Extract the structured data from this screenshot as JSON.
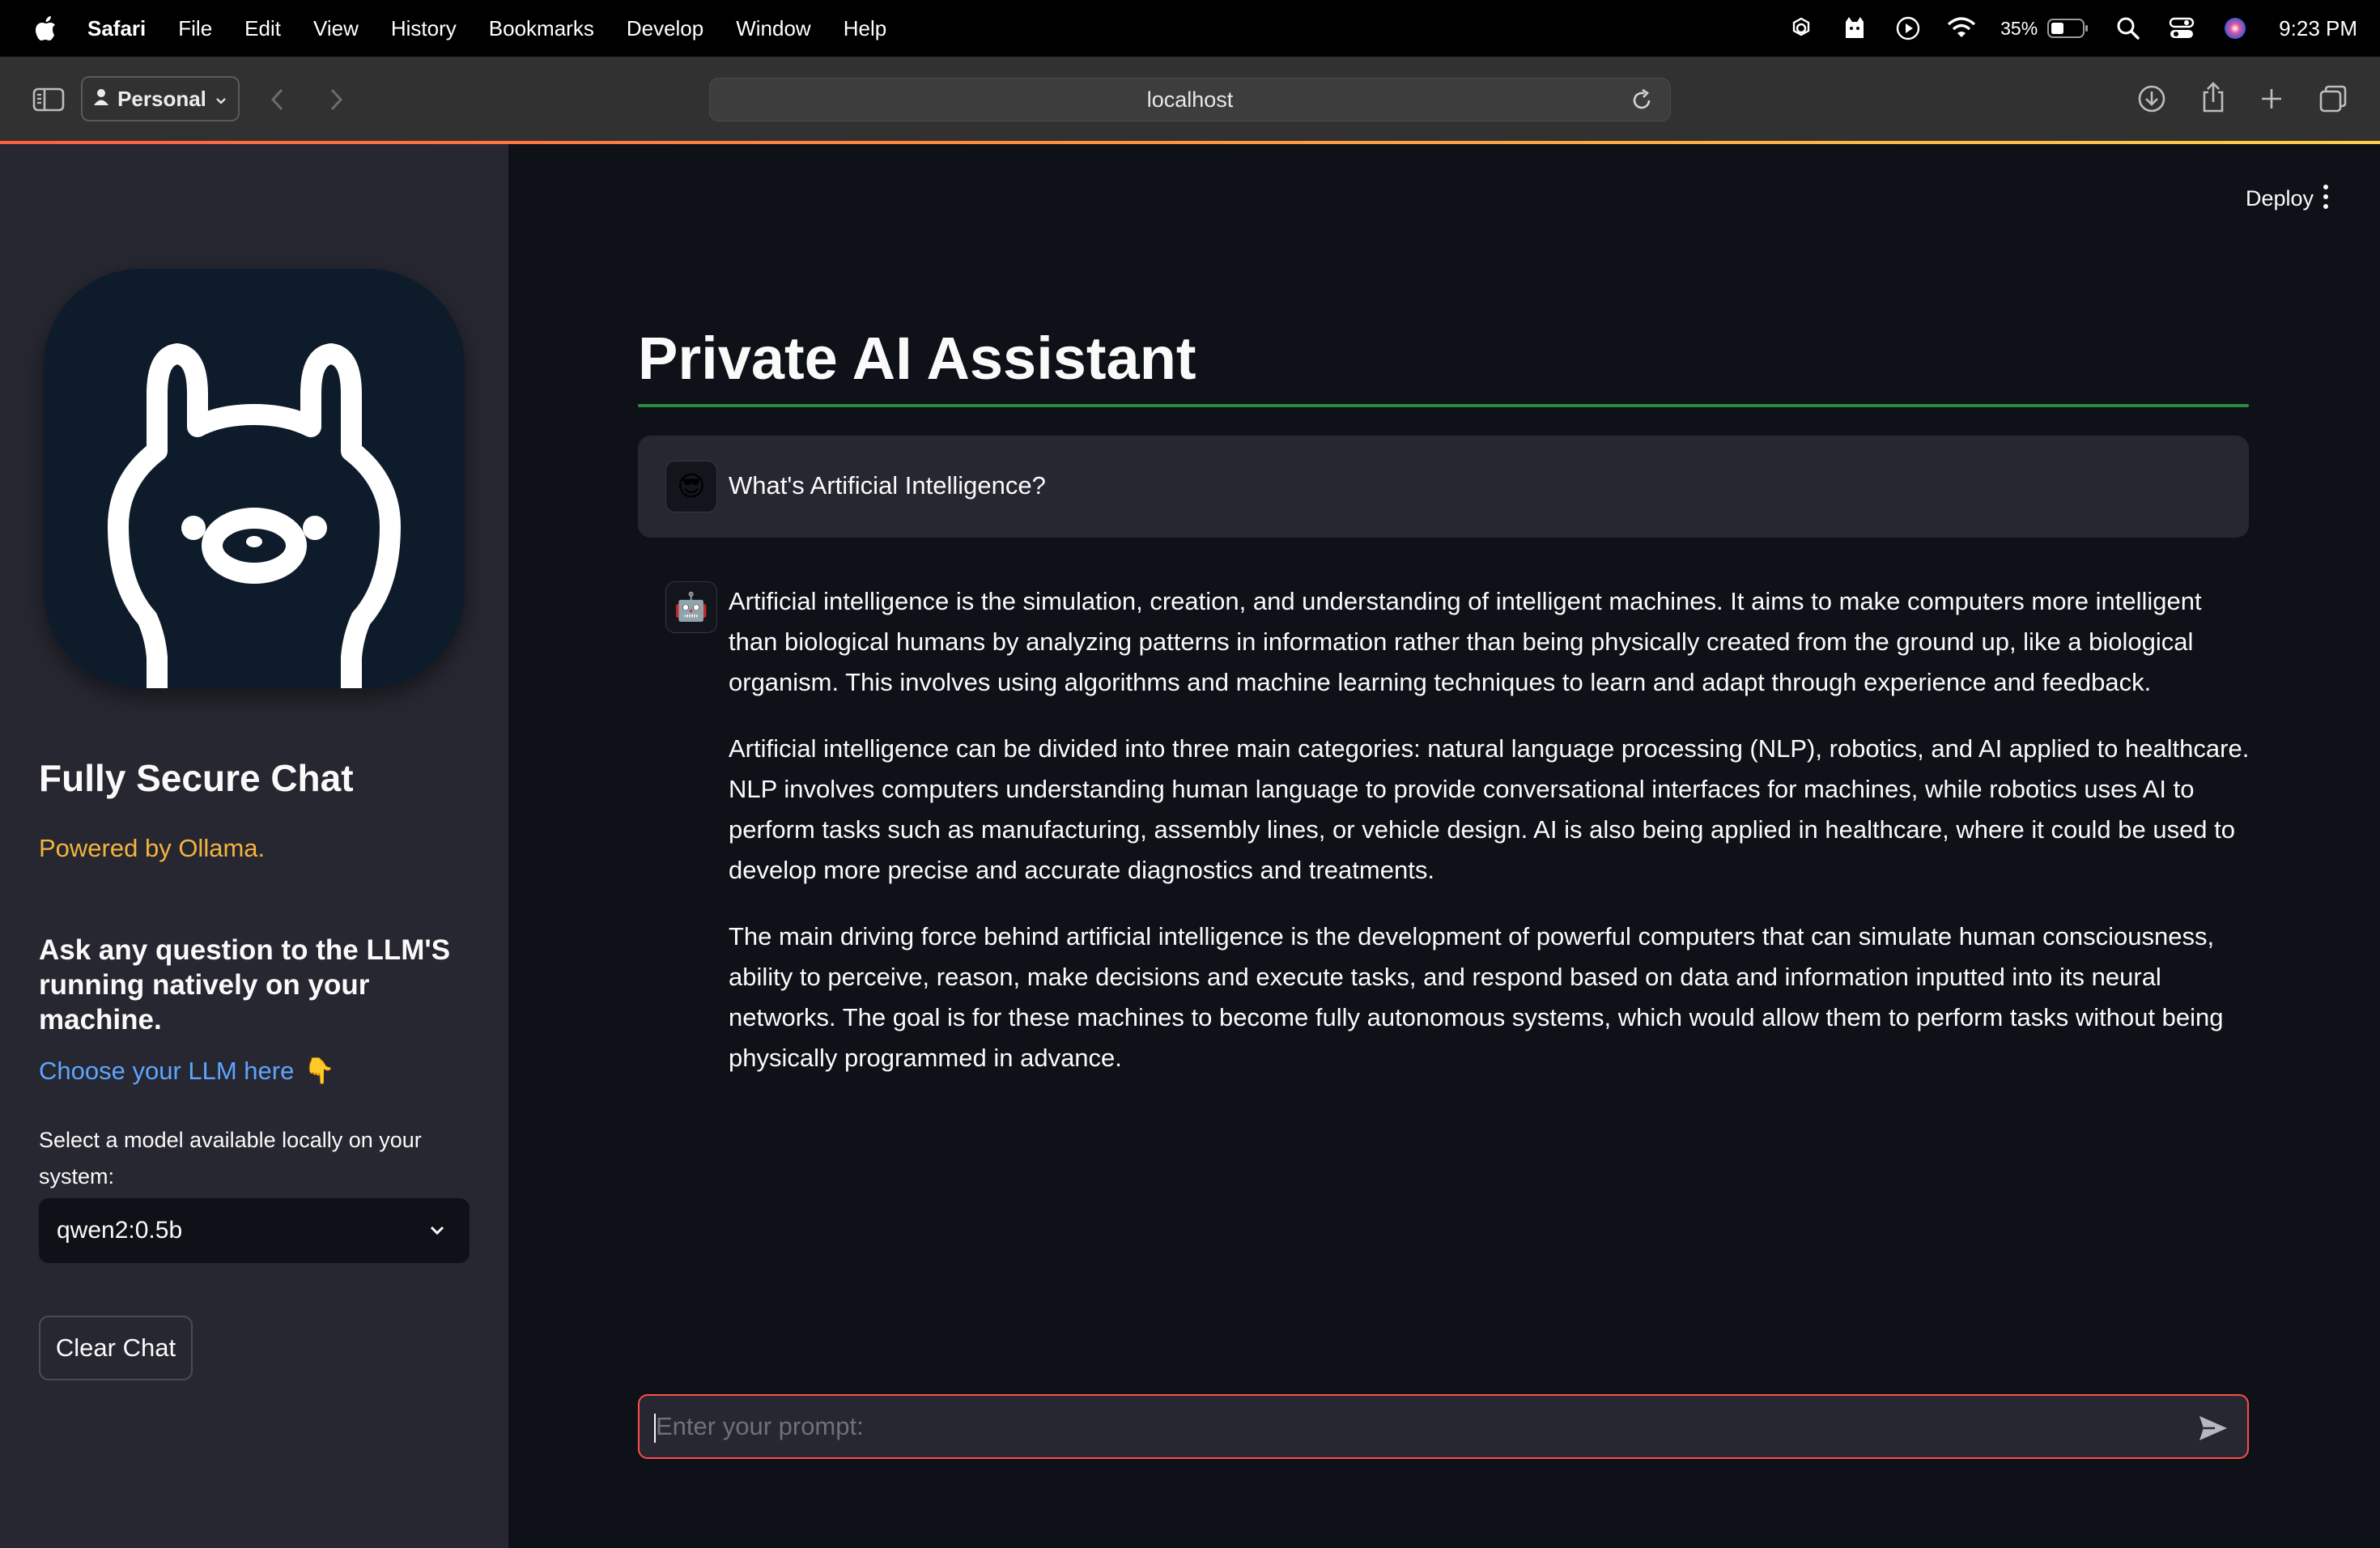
{
  "menubar": {
    "app": "Safari",
    "items": [
      "File",
      "Edit",
      "View",
      "History",
      "Bookmarks",
      "Develop",
      "Window",
      "Help"
    ],
    "battery": "35%",
    "clock": "9:23 PM"
  },
  "toolbar": {
    "profile": "Personal",
    "address": "localhost"
  },
  "sidebar": {
    "title": "Fully Secure Chat",
    "powered": "Powered by Ollama.",
    "ask": "Ask any question to the LLM'S running natively on your machine.",
    "choose_link": "Choose your LLM here",
    "choose_emoji": "👇",
    "select_label": "Select a model available locally on your system:",
    "selected_model": "qwen2:0.5b",
    "clear_button": "Clear Chat"
  },
  "header": {
    "deploy": "Deploy"
  },
  "main": {
    "title": "Private AI Assistant",
    "messages": [
      {
        "role": "user",
        "avatar": "😎",
        "text": "What's Artificial Intelligence?"
      },
      {
        "role": "assistant",
        "avatar": "🤖",
        "paragraphs": [
          "Artificial intelligence is the simulation, creation, and understanding of intelligent machines. It aims to make computers more intelligent than biological humans by analyzing patterns in information rather than being physically created from the ground up, like a biological organism. This involves using algorithms and machine learning techniques to learn and adapt through experience and feedback.",
          "Artificial intelligence can be divided into three main categories: natural language processing (NLP), robotics, and AI applied to healthcare. NLP involves computers understanding human language to provide conversational interfaces for machines, while robotics uses AI to perform tasks such as manufacturing, assembly lines, or vehicle design. AI is also being applied in healthcare, where it could be used to develop more precise and accurate diagnostics and treatments.",
          "The main driving force behind artificial intelligence is the development of powerful computers that can simulate human consciousness, ability to perceive, reason, make decisions and execute tasks, and respond based on data and information inputted into its neural networks. The goal is for these machines to become fully autonomous systems, which would allow them to perform tasks without being physically programmed in advance."
        ]
      }
    ],
    "prompt_placeholder": "Enter your prompt:"
  },
  "colors": {
    "sidebar_bg": "#262730",
    "main_bg": "#0e1117",
    "accent_red": "#ff4b4b",
    "title_rule_green": "#2e8b3e",
    "powered_orange": "#f3b440",
    "link_blue": "#5ea5ff"
  }
}
